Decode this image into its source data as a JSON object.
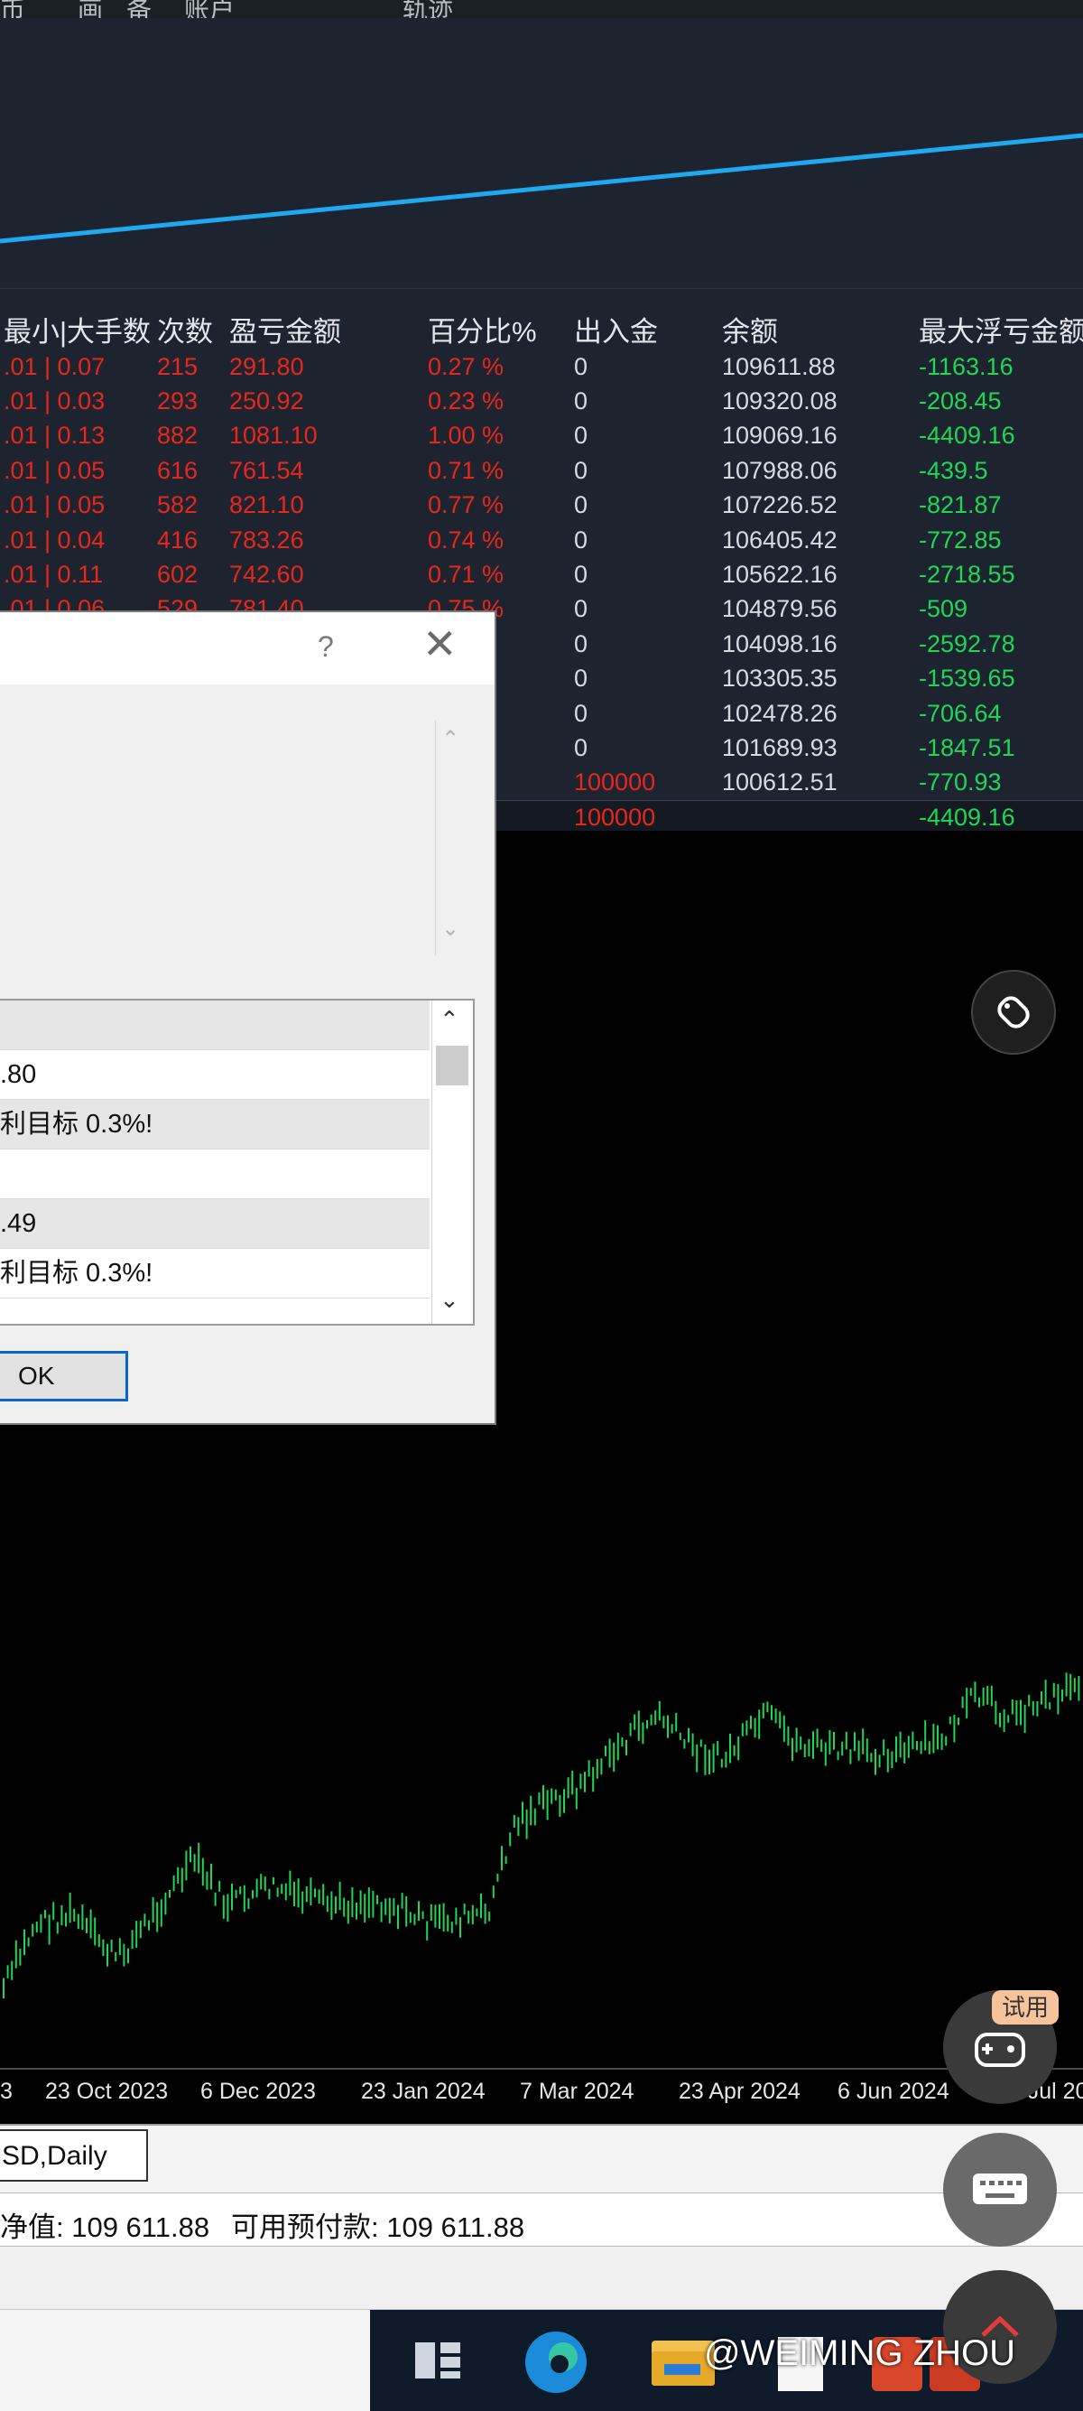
{
  "menu": [
    "币",
    "画",
    "备",
    "账户",
    "轨迹"
  ],
  "stats_table": {
    "headers": [
      "最小|大手数",
      "次数",
      "盈亏金额",
      "百分比%",
      "出入金",
      "余额",
      "最大浮亏金额"
    ],
    "rows": [
      {
        "lots": ".01 | 0.07",
        "count": "215",
        "pnl": "291.80",
        "pct": "0.27 %",
        "flow": "0",
        "balance": "109611.88",
        "float": "-1163.16"
      },
      {
        "lots": ".01 | 0.03",
        "count": "293",
        "pnl": "250.92",
        "pct": "0.23 %",
        "flow": "0",
        "balance": "109320.08",
        "float": "-208.45"
      },
      {
        "lots": ".01 | 0.13",
        "count": "882",
        "pnl": "1081.10",
        "pct": "1.00 %",
        "flow": "0",
        "balance": "109069.16",
        "float": "-4409.16"
      },
      {
        "lots": ".01 | 0.05",
        "count": "616",
        "pnl": "761.54",
        "pct": "0.71 %",
        "flow": "0",
        "balance": "107988.06",
        "float": "-439.5"
      },
      {
        "lots": ".01 | 0.05",
        "count": "582",
        "pnl": "821.10",
        "pct": "0.77 %",
        "flow": "0",
        "balance": "107226.52",
        "float": "-821.87"
      },
      {
        "lots": ".01 | 0.04",
        "count": "416",
        "pnl": "783.26",
        "pct": "0.74 %",
        "flow": "0",
        "balance": "106405.42",
        "float": "-772.85"
      },
      {
        "lots": ".01 | 0.11",
        "count": "602",
        "pnl": "742.60",
        "pct": "0.71 %",
        "flow": "0",
        "balance": "105622.16",
        "float": "-2718.55"
      },
      {
        "lots": ".01 | 0.06",
        "count": "529",
        "pnl": "781.40",
        "pct": "0.75 %",
        "flow": "0",
        "balance": "104879.56",
        "float": "-509"
      },
      {
        "lots": "",
        "count": "",
        "pnl": "",
        "pct": "%",
        "flow": "0",
        "balance": "104098.16",
        "float": "-2592.78"
      },
      {
        "lots": "",
        "count": "",
        "pnl": "",
        "pct": "%",
        "flow": "0",
        "balance": "103305.35",
        "float": "-1539.65"
      },
      {
        "lots": "",
        "count": "",
        "pnl": "",
        "pct": "%",
        "flow": "0",
        "balance": "102478.26",
        "float": "-706.64"
      },
      {
        "lots": "",
        "count": "",
        "pnl": "",
        "pct": "%",
        "flow": "0",
        "balance": "101689.93",
        "float": "-1847.51"
      },
      {
        "lots": "",
        "count": "",
        "pnl": "",
        "pct": "%",
        "flow": "100000",
        "balance": "100612.51",
        "float": "-770.93"
      }
    ],
    "total_row": {
      "pct": "%",
      "flow": "100000",
      "balance": "",
      "float": "-4409.16"
    }
  },
  "dialog": {
    "help_label": "?",
    "close_label": "✕",
    "up_arrow": "⌃",
    "down_arrow": "⌄",
    "list_rows": [
      ".80",
      "利目标 0.3%!",
      "",
      ".49",
      "利目标 0.3%!"
    ],
    "ok_label": "OK"
  },
  "date_axis": [
    "3",
    "23 Oct 2023",
    "6 Dec 2023",
    "23 Jan 2024",
    "7 Mar 2024",
    "23 Apr 2024",
    "6 Jun 2024",
    "22 Jul 20"
  ],
  "symbol_tab": "SD,Daily",
  "account_bar": {
    "equity_text": "净值: 109 611.88",
    "free_margin_text": "可用预付款: 109 611.88"
  },
  "overlay": {
    "trial_badge": "试用",
    "watermark": "@WEIMING ZHOU"
  },
  "colors": {
    "equity_line": "#1fa9f0",
    "candle": "#1fd655",
    "loss": "#e8271c",
    "float_loss": "#1fd655"
  }
}
